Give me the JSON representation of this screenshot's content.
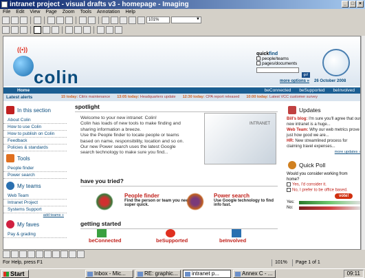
{
  "window": {
    "title": "intranet project - visual drafts v3 - homepage - Imaging",
    "controls": [
      "_",
      "□",
      "×"
    ]
  },
  "menu": [
    "File",
    "Edit",
    "View",
    "Page",
    "Zoom",
    "Tools",
    "Annotation",
    "Help"
  ],
  "toolbar": {
    "zoom_value": "101%"
  },
  "site": {
    "logo_text": "colin",
    "quickfind": {
      "title_a": "quick",
      "title_b": "find",
      "opt1": "people/teams",
      "opt2": "pages/documents",
      "go": "go!",
      "more": "more options »"
    },
    "date": "26 October 2008",
    "nav": {
      "home": "Home",
      "links": [
        "beConnected",
        "beSupported",
        "beInvolved"
      ]
    },
    "alerts": {
      "label": "Latest alerts",
      "items": [
        {
          "time": "15 today:",
          "text": "Citrix maintenance"
        },
        {
          "time": "13:05 today:",
          "text": "Headquarters update"
        },
        {
          "time": "12:30 today:",
          "text": "CPA report released"
        },
        {
          "time": "10:00 today:",
          "text": "Latest VCC customer survey"
        }
      ]
    },
    "left": {
      "in_section": {
        "title": "In this section",
        "items": [
          "About Colin",
          "How to use Colin",
          "How to publish on Colin",
          "Feedback",
          "Policies & standards"
        ]
      },
      "tools": {
        "title": "Tools",
        "items": [
          "People finder",
          "Power search"
        ]
      },
      "teams": {
        "title": "My teams",
        "items": [
          "Web Team",
          "Intranet Project",
          "Systems Support"
        ],
        "add": "add teams »"
      },
      "faves": {
        "title": "My faves",
        "items": [
          "Pay & grading"
        ]
      }
    },
    "center": {
      "spotlight_title": "spotlight",
      "spotlight_lines": [
        "Welcome to your new intranet: Colin!",
        "Colin has loads of new tools to make finding and",
        "sharing information a breeze.",
        "Use the People finder to locate people or teams",
        "based on name, responsibility, location and so on.",
        "Our new Power search uses the latest Google",
        "search technology to make sure you find..."
      ],
      "spotlight_image_text": "INTRANET",
      "tried_title": "have you tried?",
      "try1": {
        "title": "People finder",
        "desc": "Find the person or team you need super quick."
      },
      "try2": {
        "title": "Power search",
        "desc": "Use Google technology to find info fast."
      },
      "getstart_title": "getting started",
      "getstart": [
        "beConnected",
        "beSupported",
        "beInvolved"
      ]
    },
    "right": {
      "updates_title": "Updates",
      "updates": [
        {
          "who": "Bill's blog:",
          "text": "I'm sure you'll agree that our new intranet is a huge..."
        },
        {
          "who": "Web Team:",
          "text": "Why our web metrics prove just how good we are..."
        },
        {
          "who": "HR:",
          "text": "New streamlined process for claiming travel expenses..."
        }
      ],
      "more_updates": "more updates »",
      "poll_title": "Quick Poll",
      "poll_q": "Would you consider working from home?",
      "poll_opt1": "Yes, I'd consider it.",
      "poll_opt2": "No, I prefer to be office based.",
      "vote": "vote!",
      "yes_label": "Yes:",
      "no_label": "No:"
    }
  },
  "status": {
    "help": "For Help, press F1",
    "zoom": "101%",
    "page": "Page 1 of 1"
  },
  "taskbar": {
    "start": "Start",
    "tasks": [
      "Inbox - Mic...",
      "RE: graphic...",
      "intranet p...",
      "Annex C - ..."
    ],
    "time": "09:11"
  }
}
